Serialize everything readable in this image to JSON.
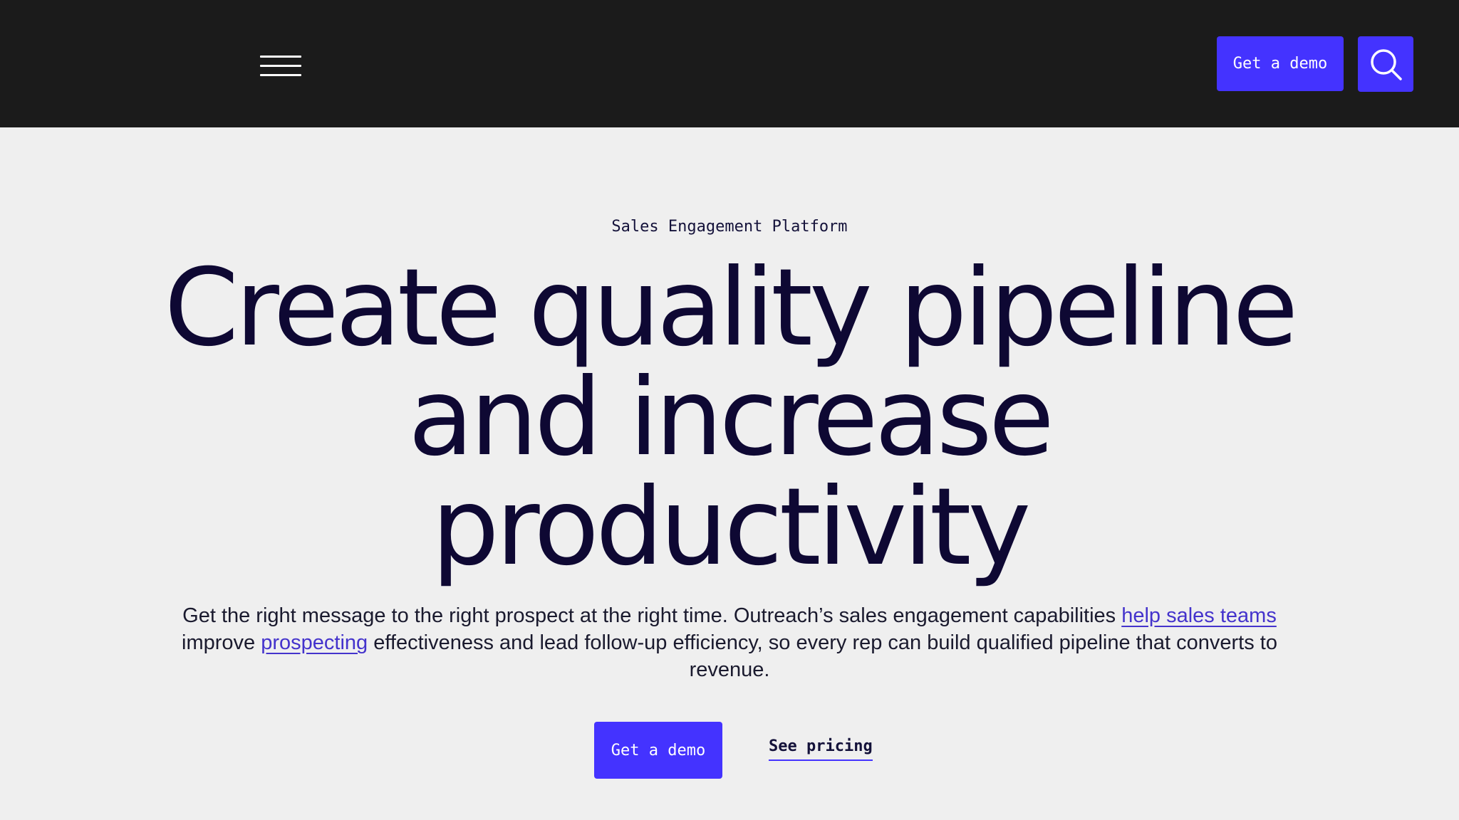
{
  "header": {
    "menu_icon": "hamburger-menu-icon",
    "demo_label": "Get a demo",
    "search_icon": "search-icon"
  },
  "hero": {
    "eyebrow": "Sales Engagement Platform",
    "headline_line1": "Create quality pipeline",
    "headline_line2": "and increase",
    "headline_line3": "productivity",
    "subtext": {
      "part1": "Get the right message to the right prospect at the right time. Outreach’s sales engagement capabilities ",
      "link1": "help sales teams",
      "part2": " improve ",
      "link2": "prospecting",
      "part3": " effectiveness and lead follow-up efficiency, so every rep can build qualified pipeline that converts to revenue."
    },
    "cta_demo": "Get a demo",
    "cta_pricing": "See pricing"
  },
  "colors": {
    "accent": "#4433ff",
    "header_bg": "#1b1b1b",
    "page_bg": "#efefef",
    "headline": "#0e0833"
  }
}
